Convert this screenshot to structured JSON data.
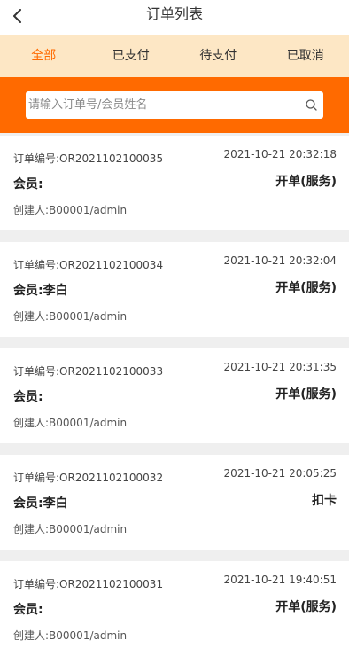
{
  "header": {
    "title": "订单列表"
  },
  "tabs": [
    {
      "label": "全部",
      "active": true
    },
    {
      "label": "已支付",
      "active": false
    },
    {
      "label": "待支付",
      "active": false
    },
    {
      "label": "已取消",
      "active": false
    }
  ],
  "search": {
    "placeholder": "请输入订单号/会员姓名",
    "value": ""
  },
  "orders": [
    {
      "order_no": "订单编号:OR2021102100035",
      "time": "2021-10-21 20:32:18",
      "member": "会员:",
      "status": "开单(服务)",
      "creator": "创建人:B00001/admin"
    },
    {
      "order_no": "订单编号:OR2021102100034",
      "time": "2021-10-21 20:32:04",
      "member": "会员:李白",
      "status": "开单(服务)",
      "creator": "创建人:B00001/admin"
    },
    {
      "order_no": "订单编号:OR2021102100033",
      "time": "2021-10-21 20:31:35",
      "member": "会员:",
      "status": "开单(服务)",
      "creator": "创建人:B00001/admin"
    },
    {
      "order_no": "订单编号:OR2021102100032",
      "time": "2021-10-21 20:05:25",
      "member": "会员:李白",
      "status": "扣卡",
      "creator": "创建人:B00001/admin"
    },
    {
      "order_no": "订单编号:OR2021102100031",
      "time": "2021-10-21 19:40:51",
      "member": "会员:",
      "status": "开单(服务)",
      "creator": "创建人:B00001/admin"
    }
  ],
  "colors": {
    "accent": "#ff6a00",
    "tab_background": "#fde7c5",
    "page_background": "#efefef"
  },
  "icons": {
    "back": "chevron-left-icon",
    "search": "search-icon"
  }
}
